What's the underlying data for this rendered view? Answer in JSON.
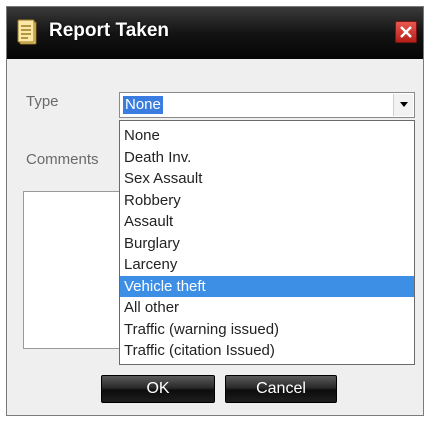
{
  "dialog": {
    "title": "Report Taken",
    "title_icon": "report-document-icon",
    "close_icon": "close-icon"
  },
  "form": {
    "type_label": "Type",
    "comments_label": "Comments",
    "type_selected": "None",
    "comments_value": ""
  },
  "dropdown": {
    "options": [
      "None",
      "Death Inv.",
      "Sex Assault",
      "Robbery",
      "Assault",
      "Burglary",
      "Larceny",
      "Vehicle theft",
      "All other",
      "Traffic (warning issued)",
      "Traffic (citation Issued)"
    ],
    "highlighted": "Vehicle theft"
  },
  "buttons": {
    "ok": "OK",
    "cancel": "Cancel"
  },
  "colors": {
    "highlight": "#3d8fe6",
    "close_button": "#c9302a",
    "titlebar": "#141414"
  }
}
